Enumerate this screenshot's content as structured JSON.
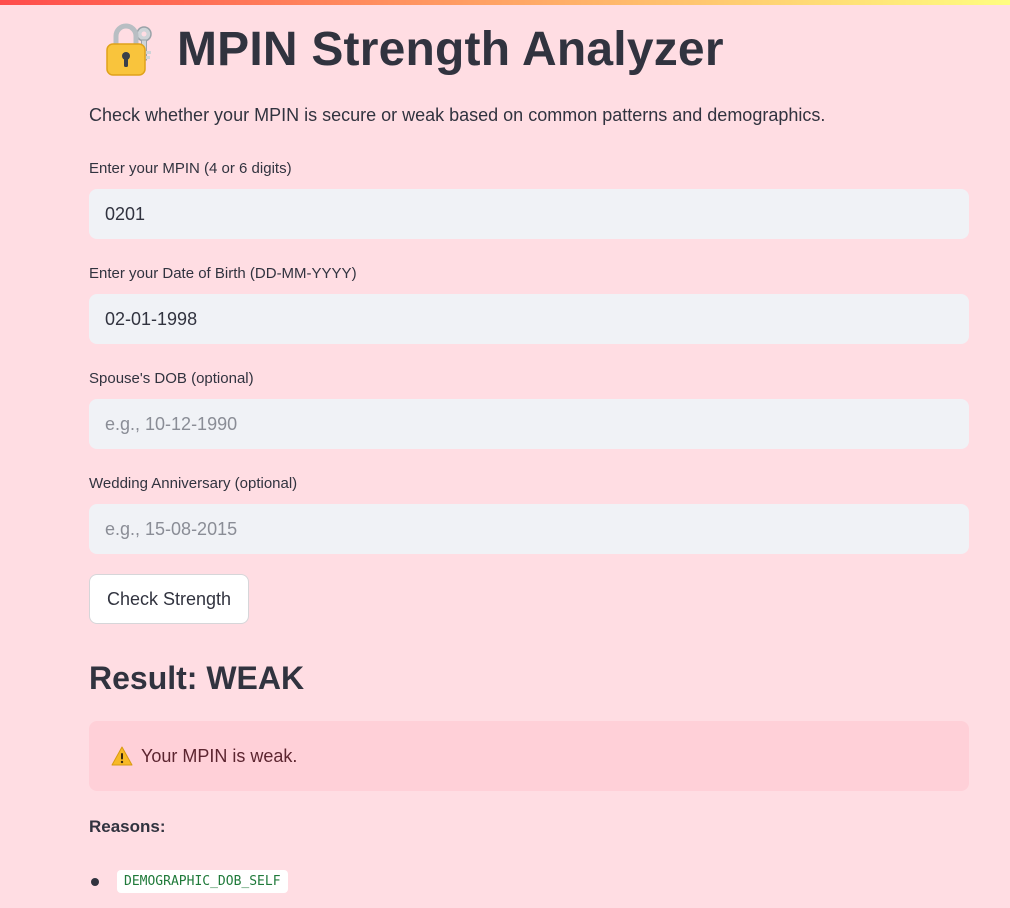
{
  "page": {
    "title": "MPIN Strength Analyzer",
    "title_icon": "lock-with-key-icon",
    "subtitle": "Check whether your MPIN is secure or weak based on common patterns and demographics."
  },
  "form": {
    "mpin": {
      "label": "Enter your MPIN (4 or 6 digits)",
      "value": "0201",
      "placeholder": ""
    },
    "dob": {
      "label": "Enter your Date of Birth (DD-MM-YYYY)",
      "value": "02-01-1998",
      "placeholder": ""
    },
    "spouse_dob": {
      "label": "Spouse's DOB (optional)",
      "value": "",
      "placeholder": "e.g., 10-12-1990"
    },
    "anniversary": {
      "label": "Wedding Anniversary (optional)",
      "value": "",
      "placeholder": "e.g., 15-08-2015"
    },
    "submit_label": "Check Strength"
  },
  "result": {
    "heading": "Result: WEAK",
    "alert_icon": "warning-icon",
    "alert_text": "Your MPIN is weak.",
    "reasons_label": "Reasons:",
    "reasons": [
      "DEMOGRAPHIC_DOB_SELF"
    ]
  },
  "colors": {
    "background": "#ffdde3",
    "input_background": "#f0f2f6",
    "alert_background": "#ffd0d8",
    "text": "#31333f",
    "code_text": "#1f7a3a"
  }
}
